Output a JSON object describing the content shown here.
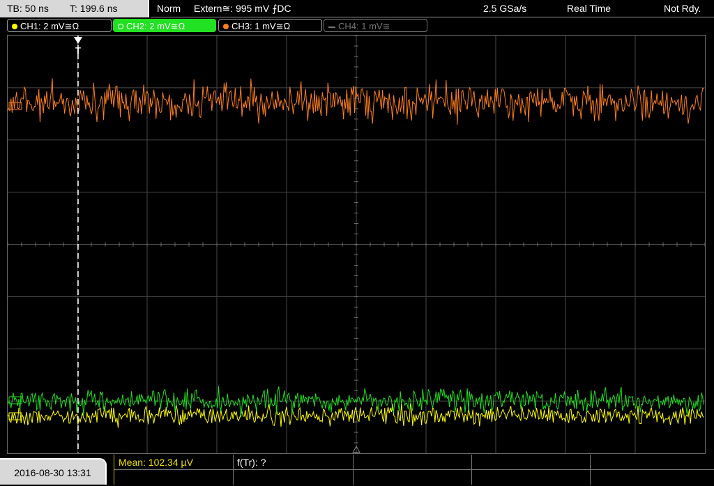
{
  "status": {
    "timebase": "TB: 50 ns",
    "trigger_time": "T: 199.6 ns",
    "trigger_mode": "Norm",
    "trigger_source": "Extern≅: 995 mV ⨍DC",
    "sample_rate": "2.5 GSa/s",
    "acquisition": "Real Time",
    "state": "Not Rdy."
  },
  "channels": [
    {
      "label": "CH1: 2 mV≅Ω",
      "color": "#ffff00",
      "active": true
    },
    {
      "label": "CH2: 2 mV≅Ω",
      "color": "#00ff00",
      "active": true,
      "selected": true
    },
    {
      "label": "CH3: 1 mV≅Ω",
      "color": "#ff7f1e",
      "active": true
    },
    {
      "label": "CH4: 1 mV≅",
      "color": "#808080",
      "active": false
    }
  ],
  "trigger_marker": "T",
  "footer": {
    "datetime": "2016-08-30 13:31",
    "mean_label": "Mean: 102.34 µV",
    "freq_label": "f(Tr): ?"
  },
  "colors": {
    "ch1": "#ffff00",
    "ch2": "#1ee01e",
    "ch3": "#ff7f1e",
    "grid": "#4a4a4a",
    "trigger": "#ffffff"
  }
}
